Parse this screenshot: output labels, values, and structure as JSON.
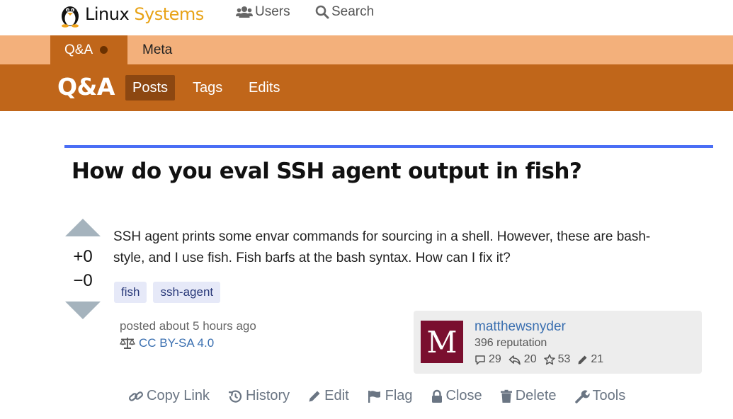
{
  "header": {
    "logo": {
      "part1": "Linux",
      "part2": "Systems"
    },
    "nav": [
      {
        "label": "Users",
        "icon": "users-icon"
      },
      {
        "label": "Search",
        "icon": "search-icon"
      }
    ]
  },
  "community_tabs": [
    {
      "label": "Q&A",
      "active": true,
      "has_dot": true
    },
    {
      "label": "Meta",
      "active": false
    }
  ],
  "section": {
    "title": "Q&A",
    "nav": [
      {
        "label": "Posts",
        "active": true
      },
      {
        "label": "Tags",
        "active": false
      },
      {
        "label": "Edits",
        "active": false
      }
    ]
  },
  "post": {
    "title": "How do you eval SSH agent output in fish?",
    "body_line1": "SSH agent prints some envar commands for sourcing in a shell. However, these are bash-",
    "body_line2": "style, and I use fish. Fish barfs at the bash syntax. How can I fix it?",
    "upvotes": "+0",
    "downvotes": "−0",
    "tags": [
      "fish",
      "ssh-agent"
    ],
    "posted": "posted about 5 hours ago",
    "license": "CC BY-SA 4.0"
  },
  "author": {
    "avatar_letter": "M",
    "avatar_color": "#7a0f2f",
    "name": "matthewsnyder",
    "reputation": "396 reputation",
    "stats": {
      "posts": "29",
      "answers": "20",
      "stars": "53",
      "edits": "21"
    }
  },
  "actions": [
    "Copy Link",
    "History",
    "Edit",
    "Flag",
    "Close",
    "Delete",
    "Tools"
  ],
  "colors": {
    "accent": "#c0661a",
    "accent_light": "#f3b07b",
    "accent_dark": "#8c4711",
    "rule": "#4a6ef5",
    "link": "#3a6fb0"
  }
}
